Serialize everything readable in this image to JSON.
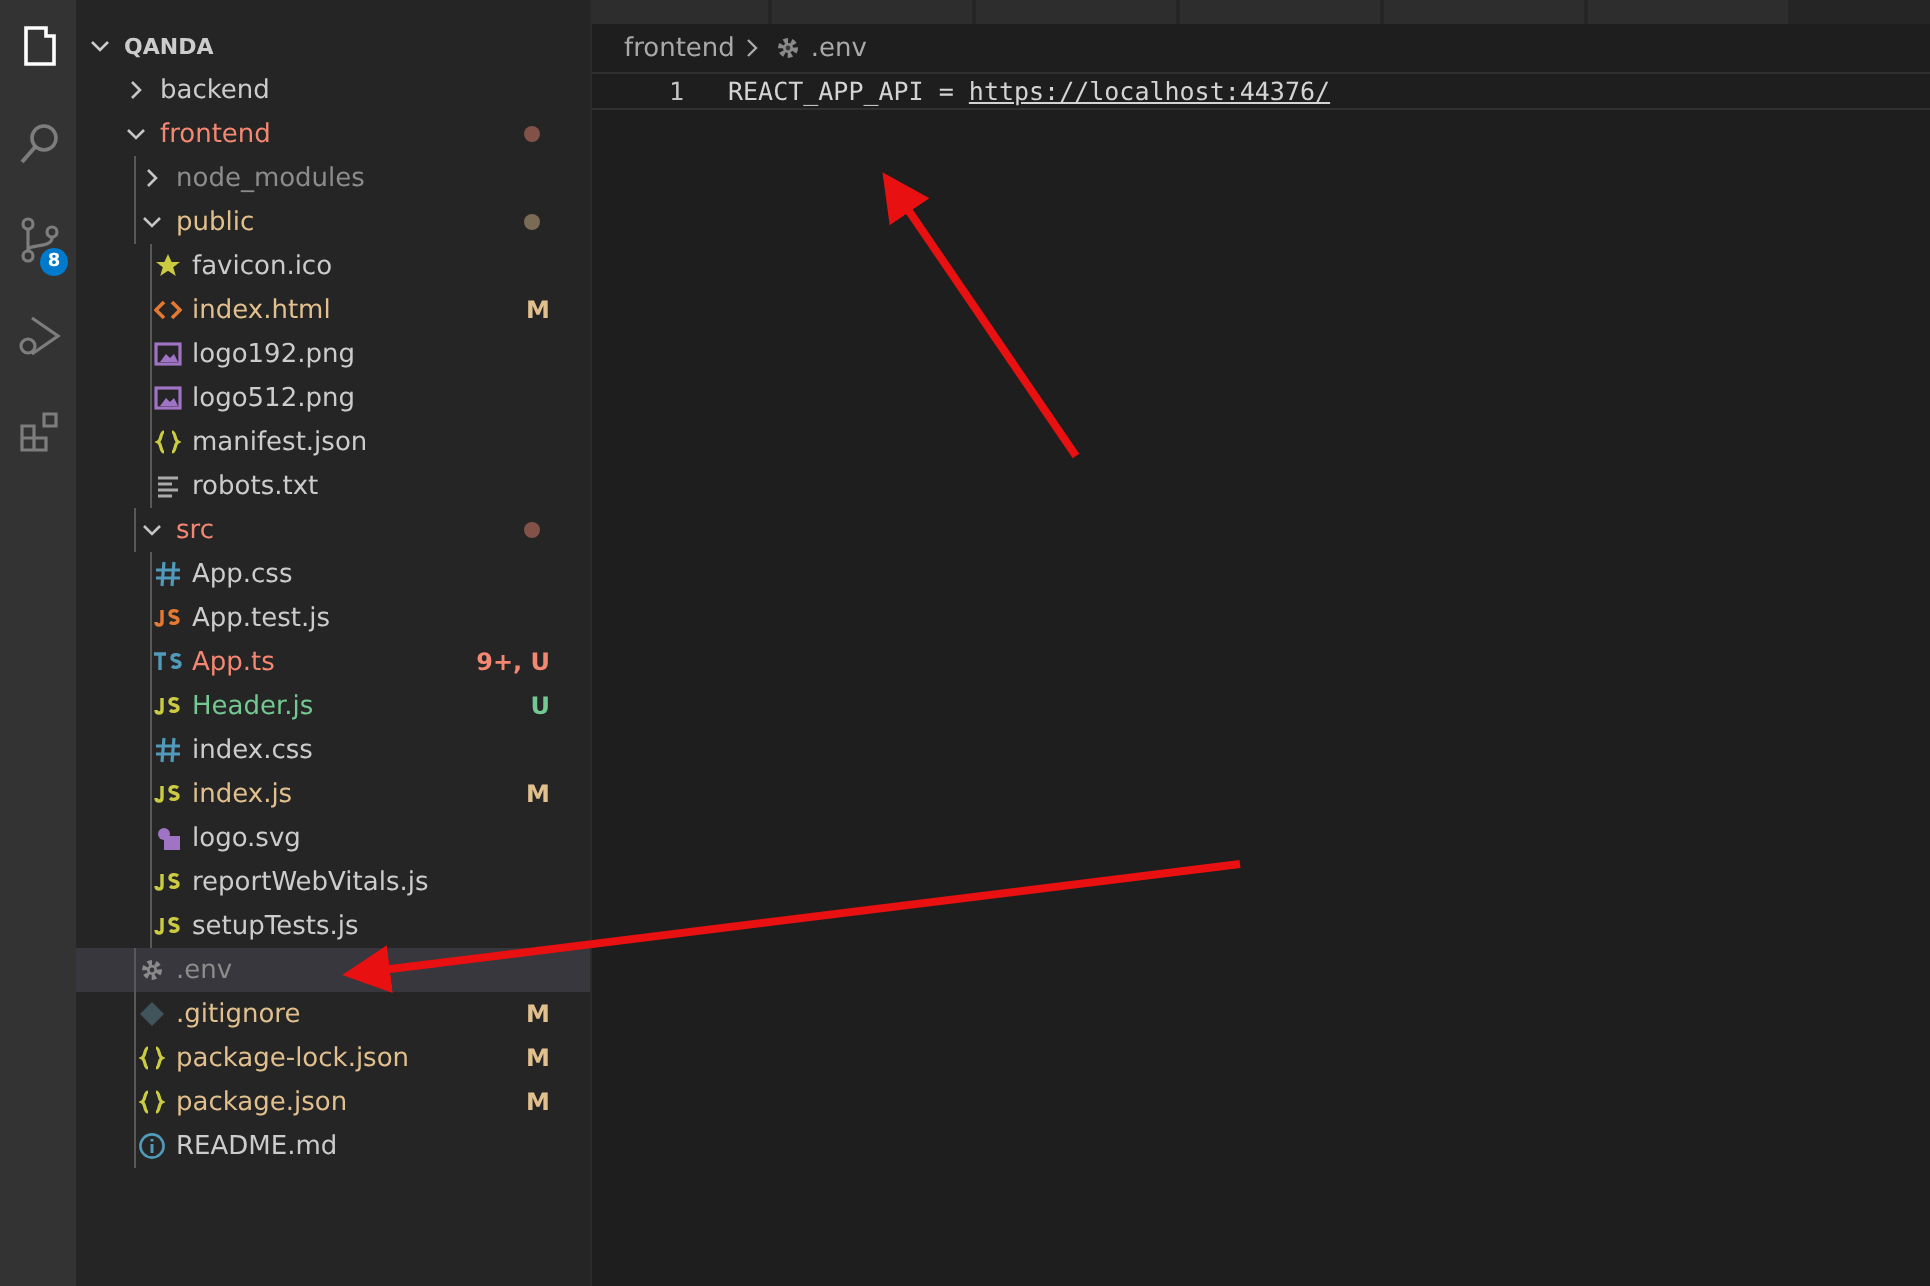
{
  "activity_bar": {
    "items": [
      {
        "kind": "files",
        "selected": true
      },
      {
        "kind": "search",
        "selected": false
      },
      {
        "kind": "source-control",
        "selected": false,
        "badge": "8"
      },
      {
        "kind": "debug",
        "selected": false
      },
      {
        "kind": "extensions",
        "selected": false
      }
    ]
  },
  "explorer": {
    "title": "QANDA",
    "expanded": true,
    "items": [
      {
        "label": "backend",
        "kind": "folder",
        "expanded": false,
        "color": "#cccccc",
        "selected": false
      },
      {
        "label": "frontend",
        "kind": "folder",
        "expanded": true,
        "color": "#f48771",
        "dot": true,
        "selected": false,
        "children": [
          {
            "label": "node_modules",
            "kind": "folder",
            "expanded": false,
            "color": "#8c8c8c",
            "selected": false
          },
          {
            "label": "public",
            "kind": "folder",
            "expanded": true,
            "color": "#e2c08d",
            "dot": true,
            "selected": false,
            "children": [
              {
                "label": "favicon.ico",
                "kind": "favicon",
                "color": "#cccccc",
                "selected": false
              },
              {
                "label": "index.html",
                "kind": "html",
                "color": "#e2c08d",
                "badge": "M",
                "selected": false
              },
              {
                "label": "logo192.png",
                "kind": "image",
                "color": "#cccccc",
                "selected": false
              },
              {
                "label": "logo512.png",
                "kind": "image",
                "color": "#cccccc",
                "selected": false
              },
              {
                "label": "manifest.json",
                "kind": "json",
                "color": "#cccccc",
                "selected": false
              },
              {
                "label": "robots.txt",
                "kind": "text",
                "color": "#cccccc",
                "selected": false
              }
            ]
          },
          {
            "label": "src",
            "kind": "folder",
            "expanded": true,
            "color": "#f48771",
            "dot": true,
            "selected": false,
            "children": [
              {
                "label": "App.css",
                "kind": "css",
                "color": "#cccccc",
                "selected": false
              },
              {
                "label": "App.test.js",
                "kind": "test",
                "color": "#cccccc",
                "selected": false
              },
              {
                "label": "App.ts",
                "kind": "ts",
                "color": "#f48771",
                "badge": "9+, U",
                "selected": false
              },
              {
                "label": "Header.js",
                "kind": "js",
                "color": "#73c991",
                "badge": "U",
                "selected": false
              },
              {
                "label": "index.css",
                "kind": "css",
                "color": "#cccccc",
                "selected": false
              },
              {
                "label": "index.js",
                "kind": "js",
                "color": "#e2c08d",
                "badge": "M",
                "selected": false
              },
              {
                "label": "logo.svg",
                "kind": "svg",
                "color": "#cccccc",
                "selected": false
              },
              {
                "label": "reportWebVitals.js",
                "kind": "js",
                "color": "#cccccc",
                "selected": false
              },
              {
                "label": "setupTests.js",
                "kind": "js",
                "color": "#cccccc",
                "selected": false
              }
            ]
          },
          {
            "label": ".env",
            "kind": "config",
            "color": "#8c8c8c",
            "selected": true
          },
          {
            "label": ".gitignore",
            "kind": "git",
            "color": "#e2c08d",
            "badge": "M",
            "selected": false
          },
          {
            "label": "package-lock.json",
            "kind": "json",
            "color": "#e2c08d",
            "badge": "M",
            "selected": false
          },
          {
            "label": "package.json",
            "kind": "json",
            "color": "#e2c08d",
            "badge": "M",
            "selected": false
          },
          {
            "label": "README.md",
            "kind": "readme",
            "color": "#cccccc",
            "selected": false
          }
        ]
      }
    ]
  },
  "editor": {
    "breadcrumb": {
      "folder": "frontend",
      "file": ".env"
    },
    "lines": [
      {
        "number": "1",
        "key": "REACT_APP_API = ",
        "link": "https://localhost:44376/",
        "current": true
      }
    ]
  }
}
